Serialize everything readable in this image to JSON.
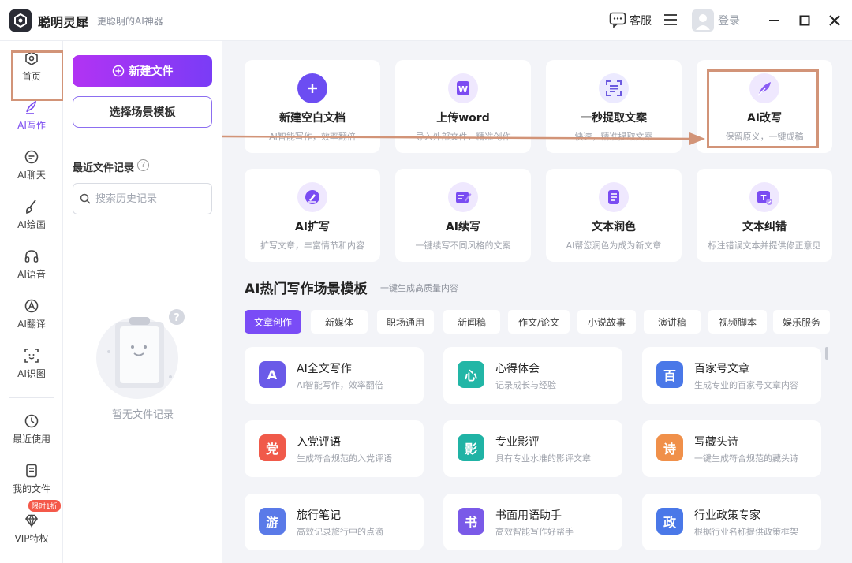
{
  "titlebar": {
    "app_name": "聪明灵犀",
    "slogan": "更聪明的AI神器",
    "service": "客服",
    "login": "登录"
  },
  "nav": {
    "items": [
      {
        "label": "首页",
        "icon": "home-icon"
      },
      {
        "label": "AI写作",
        "icon": "pen-icon"
      },
      {
        "label": "AI聊天",
        "icon": "chat-icon"
      },
      {
        "label": "AI绘画",
        "icon": "brush-icon"
      },
      {
        "label": "AI语音",
        "icon": "headphones-icon"
      },
      {
        "label": "AI翻译",
        "icon": "translate-icon"
      },
      {
        "label": "AI识图",
        "icon": "scan-icon"
      },
      {
        "label": "最近使用",
        "icon": "clock-icon"
      },
      {
        "label": "我的文件",
        "icon": "file-icon"
      },
      {
        "label": "VIP特权",
        "icon": "diamond-icon"
      }
    ],
    "vip_badge": "限时1折"
  },
  "panel": {
    "new_file": "新建文件",
    "select_template": "选择场景模板",
    "recent_title": "最近文件记录",
    "search_placeholder": "搜索历史记录",
    "empty": "暂无文件记录"
  },
  "features": [
    {
      "title": "新建空白文档",
      "sub": "AI智能写作，效率翻倍",
      "icon": "plus-icon",
      "color": "#6c4df2"
    },
    {
      "title": "上传word",
      "sub": "导入外部文件，精准创作",
      "icon": "word-icon",
      "color": "#7c4cf2"
    },
    {
      "title": "一秒提取文案",
      "sub": "快速，精准提取文案",
      "icon": "extract-icon",
      "color": "#6c5ae0"
    },
    {
      "title": "AI改写",
      "sub": "保留原义，一键成稿",
      "icon": "feather-icon",
      "color": "#8a5cf4"
    },
    {
      "title": "AI扩写",
      "sub": "扩写文章，丰富情节和内容",
      "icon": "expand-icon",
      "color": "#7a4cf2"
    },
    {
      "title": "AI续写",
      "sub": "一键续写不同风格的文案",
      "icon": "continue-icon",
      "color": "#7a4cf2"
    },
    {
      "title": "文本润色",
      "sub": "AI帮您润色为成为新文章",
      "icon": "polish-icon",
      "color": "#7a4cf2"
    },
    {
      "title": "文本纠错",
      "sub": "标注错误文本并提供修正意见",
      "icon": "correct-icon",
      "color": "#7a4cf2"
    }
  ],
  "section": {
    "title": "AI热门写作场景模板",
    "sub": "一键生成高质量内容"
  },
  "tabs": [
    "文章创作",
    "新媒体",
    "职场通用",
    "新闻稿",
    "作文/论文",
    "小说故事",
    "演讲稿",
    "视频脚本",
    "娱乐服务"
  ],
  "templates": [
    {
      "title": "AI全文写作",
      "sub": "AI智能写作，效率翻倍",
      "icon": "ai-write-icon",
      "glyph": "A",
      "color": "#6a5ae8"
    },
    {
      "title": "心得体会",
      "sub": "记录成长与经验",
      "icon": "notebook-icon",
      "glyph": "心",
      "color": "#22b6a6"
    },
    {
      "title": "百家号文章",
      "sub": "生成专业的百家号文章内容",
      "icon": "baijia-icon",
      "glyph": "百",
      "color": "#4a78e8"
    },
    {
      "title": "入党评语",
      "sub": "生成符合规范的入党评语",
      "icon": "party-icon",
      "glyph": "党",
      "color": "#f05a4a"
    },
    {
      "title": "专业影评",
      "sub": "具有专业水准的影评文章",
      "icon": "film-icon",
      "glyph": "影",
      "color": "#20b3a5"
    },
    {
      "title": "写藏头诗",
      "sub": "一键生成符合规范的藏头诗",
      "icon": "poem-icon",
      "glyph": "诗",
      "color": "#f0904a"
    },
    {
      "title": "旅行笔记",
      "sub": "高效记录旅行中的点滴",
      "icon": "travel-icon",
      "glyph": "游",
      "color": "#5a7ae8"
    },
    {
      "title": "书面用语助手",
      "sub": "高效智能写作好帮手",
      "icon": "book-icon",
      "glyph": "书",
      "color": "#7a5ae8"
    },
    {
      "title": "行业政策专家",
      "sub": "根据行业名称提供政策框架",
      "icon": "policy-icon",
      "glyph": "政",
      "color": "#4a78e8"
    }
  ]
}
